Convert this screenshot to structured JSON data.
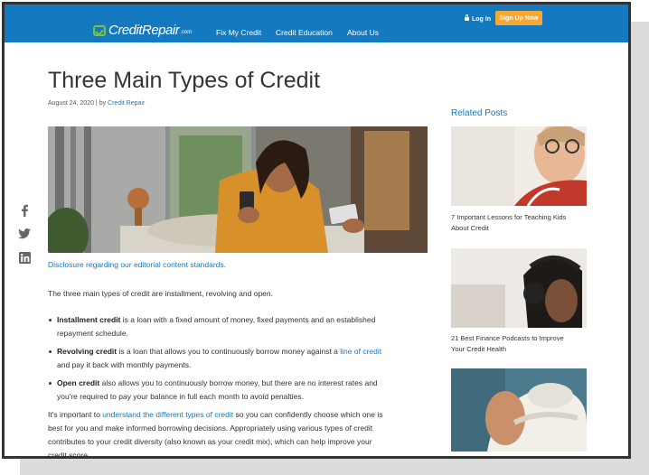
{
  "header": {
    "logo": {
      "text": "CreditRepair",
      "suffix": ".com"
    },
    "nav": [
      "Fix My Credit",
      "Credit Education",
      "About Us"
    ],
    "login_label": "Log In",
    "signup_label": "Sign Up Now"
  },
  "article": {
    "title": "Three Main Types of Credit",
    "date": "August 24, 2020 | by",
    "author": "Credit Repair",
    "disclosure": "Disclosure regarding our editorial content standards.",
    "intro": "The three main types of credit are installment, revolving and open.",
    "bullets": [
      {
        "term": "Installment credit",
        "line1": " is a loan with a fixed amount of money, fixed payments and an established",
        "line2": "repayment schedule."
      },
      {
        "term": "Revolving credit",
        "line1": " is a loan that allows you to continuously borrow money against a ",
        "link": "line of credit",
        "line2": "and pay it back with monthly payments."
      },
      {
        "term": "Open credit",
        "line1": " also allows you to continuously borrow money, but there are no interest rates and",
        "line2": "you're required to pay your balance in full each month to avoid penalties."
      }
    ],
    "closing": {
      "pre": "It's important to ",
      "link": "understand the different types of credit",
      "line1_post": " so you can confidently choose which one is",
      "line2": "best for you and make informed borrowing decisions. Appropriately using various types of credit",
      "line3": "contributes to your credit diversity (also known as your credit mix), which can help improve your",
      "line4": "credit score."
    }
  },
  "social": [
    "facebook-icon",
    "twitter-icon",
    "linkedin-icon"
  ],
  "sidebar": {
    "heading": "Related Posts",
    "posts": [
      {
        "line1": "7 Important Lessons for Teaching Kids",
        "line2": "About Credit"
      },
      {
        "line1": "21 Best Finance Podcasts to Improve",
        "line2": "Your Credit Health"
      },
      {
        "line1": "",
        "line2": ""
      }
    ]
  },
  "colors": {
    "brand_blue": "#1479be",
    "signup_orange": "#f7a832",
    "logo_green": "#79c143"
  }
}
